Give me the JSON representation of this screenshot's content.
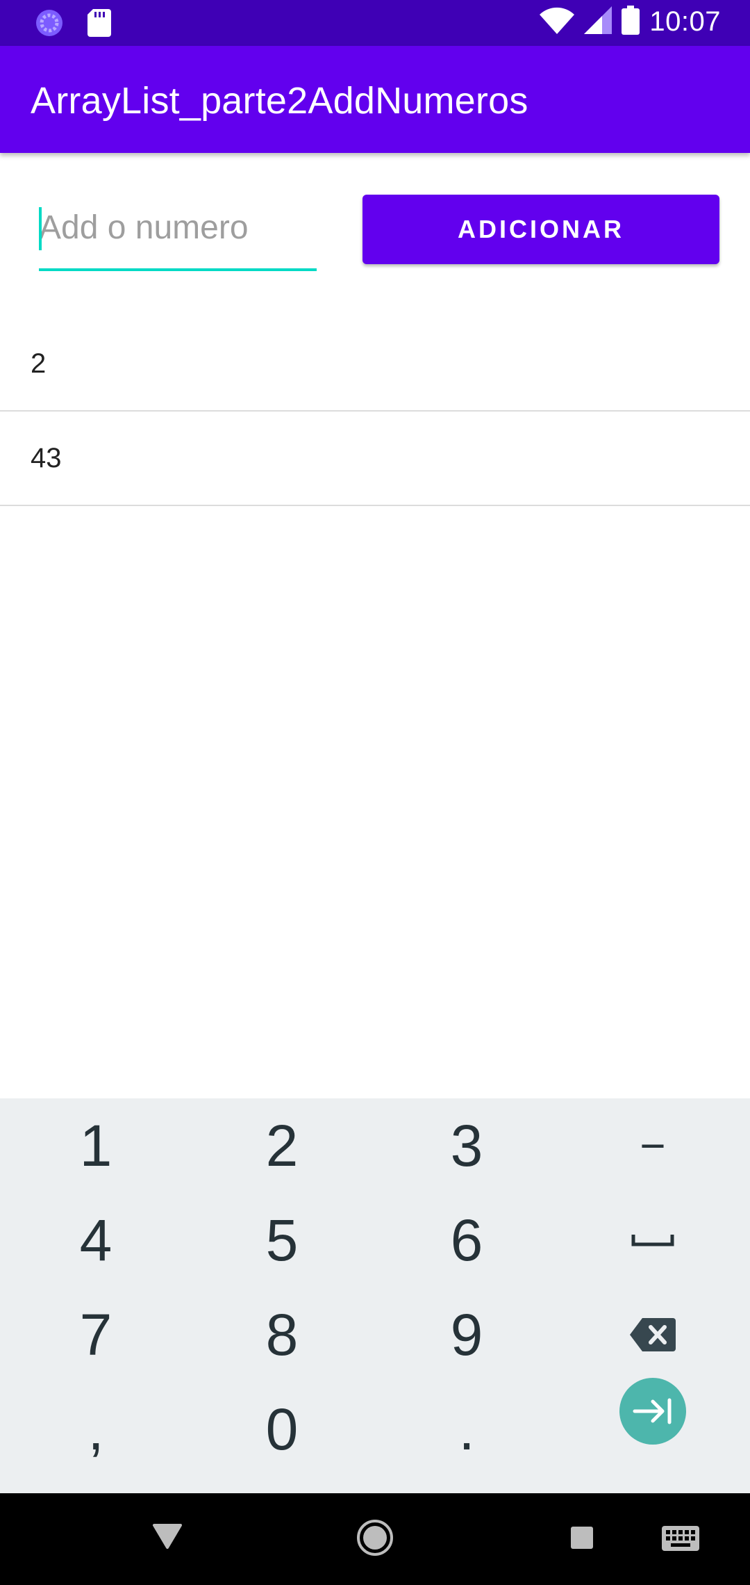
{
  "status_bar": {
    "time": "10:07",
    "icons": [
      "loading-icon",
      "sd-card-icon",
      "wifi-icon",
      "cell-signal-icon",
      "battery-icon"
    ]
  },
  "app_bar": {
    "title": "ArrayList_parte2AddNumeros"
  },
  "form": {
    "input_value": "",
    "input_placeholder": "Add o numero",
    "add_button_label": "ADICIONAR"
  },
  "list": {
    "items": [
      "2",
      "43"
    ]
  },
  "keyboard": {
    "rows": [
      [
        "1",
        "2",
        "3",
        "−"
      ],
      [
        "4",
        "5",
        "6",
        "space"
      ],
      [
        "7",
        "8",
        "9",
        "backspace"
      ],
      [
        ",",
        "0",
        ".",
        "next"
      ]
    ],
    "labels": {
      "r0k0": "1",
      "r0k1": "2",
      "r0k2": "3",
      "r0k3": "−",
      "r1k0": "4",
      "r1k1": "5",
      "r1k2": "6",
      "r2k0": "7",
      "r2k1": "8",
      "r2k2": "9",
      "r3k0": ",",
      "r3k1": "0",
      "r3k2": "."
    }
  },
  "colors": {
    "status_bar": "#3f00b5",
    "primary": "#6200ee",
    "accent": "#03dac5",
    "keyboard_bg": "#eceff1",
    "fab_key": "#4db6ac"
  }
}
